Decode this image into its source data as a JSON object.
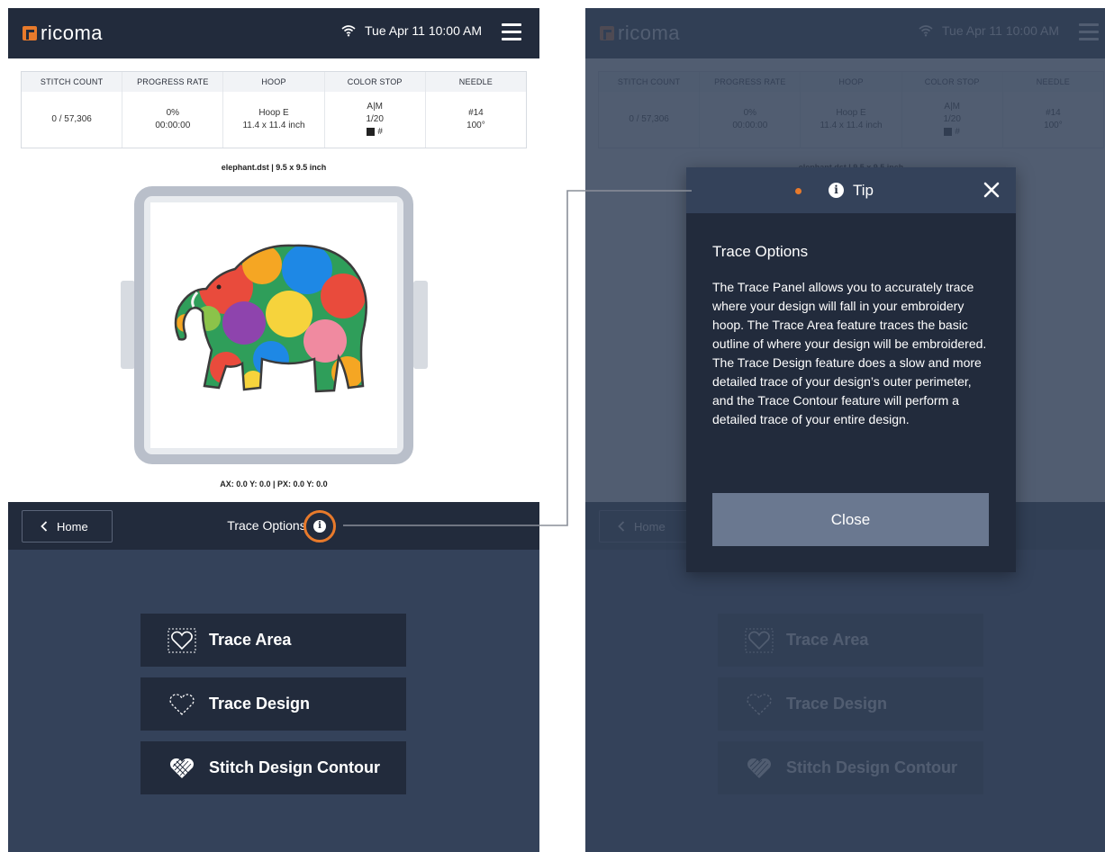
{
  "brand": {
    "name": "ricoma",
    "accent": "#e87a2b",
    "navy": "#222b3c",
    "slate": "#34425a"
  },
  "status": {
    "datetime": "Tue Apr 11  10:00 AM"
  },
  "stats": {
    "stitch_count": {
      "label": "STITCH COUNT",
      "value": "0 / 57,306"
    },
    "progress_rate": {
      "label": "PROGRESS RATE",
      "percent": "0%",
      "time": "00:00:00"
    },
    "hoop": {
      "label": "HOOP",
      "name": "Hoop E",
      "size": "11.4 x 11.4 inch"
    },
    "color_stop": {
      "label": "COLOR STOP",
      "mode": "A|M",
      "count": "1/20",
      "color": "#"
    },
    "needle": {
      "label": "NEEDLE",
      "number": "#14",
      "angle": "100°"
    }
  },
  "design": {
    "file_line": "elephant.dst  |  9.5 x 9.5 inch",
    "coords": "AX: 0.0  Y: 0.0  |  PX: 0.0  Y: 0.0"
  },
  "nav": {
    "home_label": "Home",
    "title": "Trace Options"
  },
  "trace_buttons": [
    {
      "label": "Trace Area",
      "icon": "dashed-box-heart-icon"
    },
    {
      "label": "Trace Design",
      "icon": "dashed-heart-icon"
    },
    {
      "label": "Stitch Design Contour",
      "icon": "filled-stitch-heart-icon"
    }
  ],
  "tip": {
    "header": "Tip",
    "title": "Trace Options",
    "body": "The Trace Panel allows you to accurately trace where your design will fall in your embroidery hoop. The Trace Area feature traces the basic outline of where your design will be embroidered. The Trace Design feature does a slow and more detailed trace of your design’s outer perimeter, and the Trace Contour feature will perform a detailed trace of your entire design.",
    "close_label": "Close"
  }
}
